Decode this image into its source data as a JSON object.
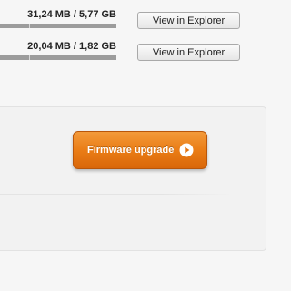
{
  "storage": [
    {
      "size_text": "31,24 MB / 5,77 GB",
      "used_fraction": 0.005,
      "button_label": "View in Explorer"
    },
    {
      "size_text": "20,04 MB / 1,82 GB",
      "used_fraction": 0.011,
      "button_label": "View in Explorer"
    }
  ],
  "firmware": {
    "button_label": "Firmware upgrade",
    "button_icon": "play-circle-icon",
    "accent_color": "#ea7d16"
  }
}
